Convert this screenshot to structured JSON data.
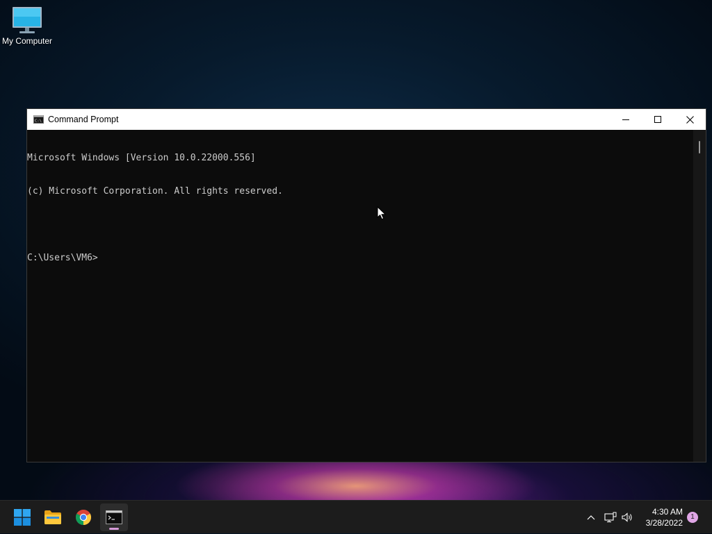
{
  "desktop": {
    "icons": [
      {
        "label": "My Computer",
        "icon": "monitor-icon"
      }
    ]
  },
  "window": {
    "title": "Command Prompt",
    "app_icon": "cmd-icon",
    "controls": {
      "minimize": "minimize-icon",
      "maximize": "maximize-icon",
      "close": "close-icon"
    },
    "console_lines": [
      "Microsoft Windows [Version 10.0.22000.556]",
      "(c) Microsoft Corporation. All rights reserved.",
      "",
      "C:\\Users\\VM6>"
    ]
  },
  "taskbar": {
    "apps": [
      {
        "name": "start",
        "icon": "windows-logo-icon"
      },
      {
        "name": "file-explorer",
        "icon": "folder-icon"
      },
      {
        "name": "chrome",
        "icon": "chrome-icon"
      },
      {
        "name": "command-prompt",
        "icon": "cmd-icon",
        "active": true
      }
    ],
    "tray": {
      "overflow_icon": "chevron-up-icon",
      "network_icon": "network-icon",
      "volume_icon": "volume-icon",
      "time": "4:30 AM",
      "date": "3/28/2022",
      "notification_count": "1"
    }
  },
  "colors": {
    "console_bg": "#0c0c0c",
    "console_text": "#cccccc",
    "taskbar_bg": "#1c1c1c",
    "active_indicator": "#d59ad8"
  }
}
